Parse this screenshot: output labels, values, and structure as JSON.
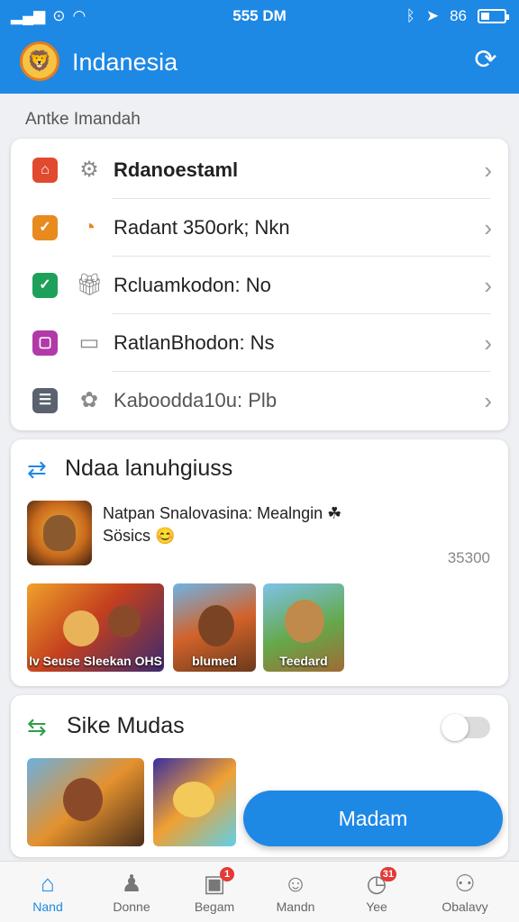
{
  "status_bar": {
    "time": "555 DM",
    "battery_text": "86"
  },
  "app_bar": {
    "title": "Indanesia",
    "logo_icon": "lion-mascot-icon",
    "refresh_icon": "refresh-icon"
  },
  "section_label": "Antke Imandah",
  "list_items": [
    {
      "label": "Rdanoestaml",
      "square_color": "#e24a2f",
      "square_icon": "bag-icon",
      "icon": "gear-icon"
    },
    {
      "label": "Radant 350ork; Nkn",
      "square_color": "#e88a1e",
      "square_icon": "check-icon",
      "icon": "compass-icon"
    },
    {
      "label": "Rcluamkodon: No",
      "square_color": "#1fa05a",
      "square_icon": "check-icon",
      "icon": "gift-icon"
    },
    {
      "label": "RatlanBhodon: Ns",
      "square_color": "#b13aa8",
      "square_icon": "square-icon",
      "icon": "chat-icon"
    },
    {
      "label": "Kaboodda10u: Plb",
      "square_color": "#5a6270",
      "square_icon": "list-icon",
      "icon": "puzzle-icon"
    }
  ],
  "promo_card": {
    "title": "Ndaa lanuhgiuss",
    "title_icon": "link-icon",
    "text": "Natpan Snalovasina: Mealngin ☘ Sösics 😊",
    "count": "35300",
    "tiles": [
      {
        "caption": "Iv Seuse Sleekan OHS"
      },
      {
        "caption": "blumed"
      },
      {
        "caption": "Teedard"
      }
    ]
  },
  "second_card": {
    "title": "Sike Mudas",
    "title_icon": "arrows-icon",
    "toggle_on": false
  },
  "fab_label": "Madam",
  "tabs": [
    {
      "label": "Nand",
      "icon": "home-icon",
      "active": true,
      "badge": ""
    },
    {
      "label": "Donne",
      "icon": "person-icon",
      "active": false,
      "badge": ""
    },
    {
      "label": "Begam",
      "icon": "bag-icon",
      "active": false,
      "badge": "1"
    },
    {
      "label": "Mandn",
      "icon": "smile-icon",
      "active": false,
      "badge": ""
    },
    {
      "label": "Yee",
      "icon": "clock-icon",
      "active": false,
      "badge": "31"
    },
    {
      "label": "Obalavy",
      "icon": "user-icon",
      "active": false,
      "badge": ""
    }
  ],
  "colors": {
    "primary": "#1e88e5",
    "background": "#eef0f3"
  }
}
